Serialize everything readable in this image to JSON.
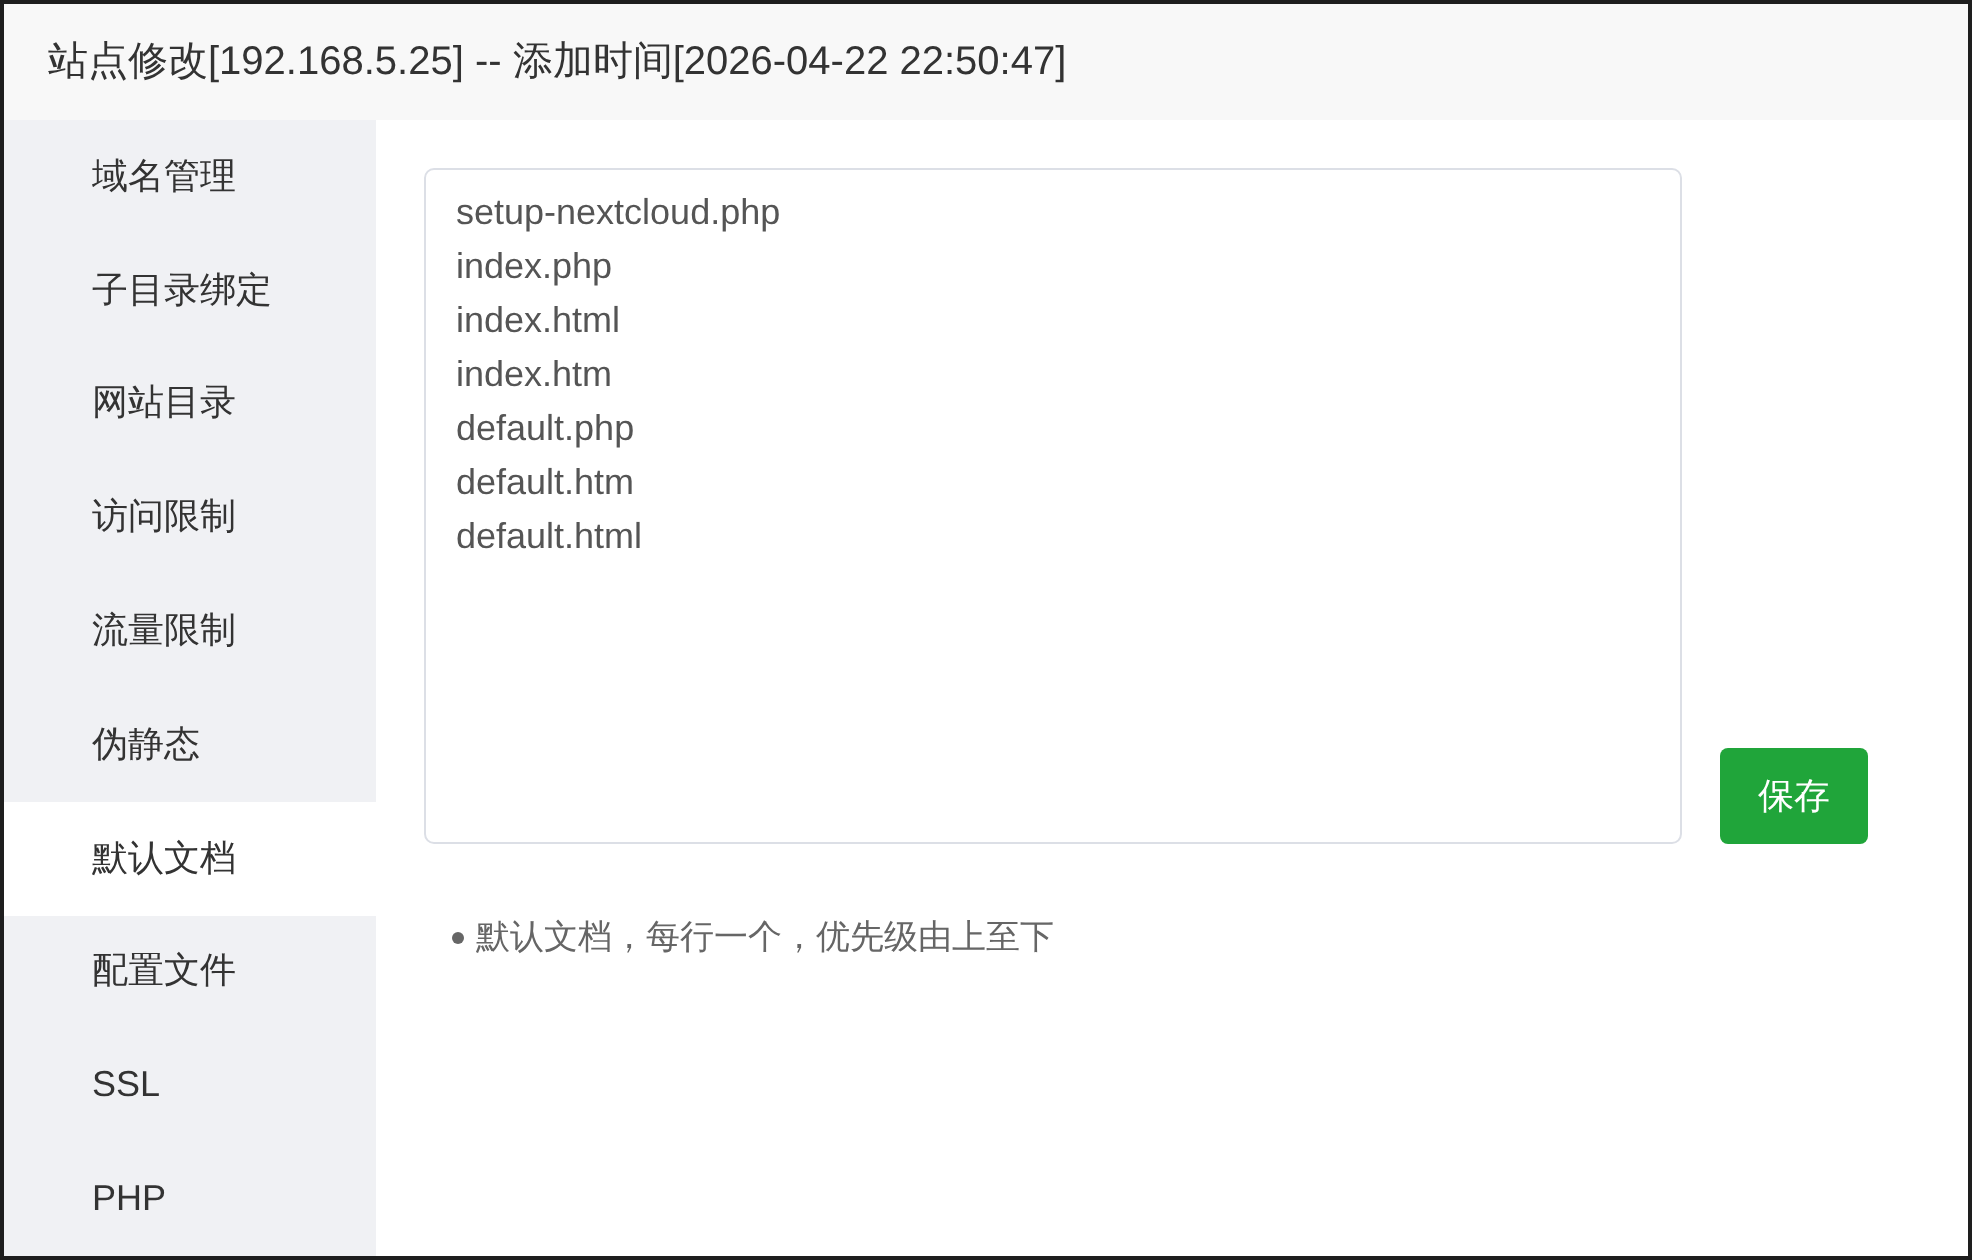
{
  "window": {
    "title": "站点修改[192.168.5.25] -- 添加时间[2026-04-22 22:50:47]"
  },
  "sidebar": {
    "items": [
      {
        "label": "域名管理",
        "selected": false
      },
      {
        "label": "子目录绑定",
        "selected": false
      },
      {
        "label": "网站目录",
        "selected": false
      },
      {
        "label": "访问限制",
        "selected": false
      },
      {
        "label": "流量限制",
        "selected": false
      },
      {
        "label": "伪静态",
        "selected": false
      },
      {
        "label": "默认文档",
        "selected": true
      },
      {
        "label": "配置文件",
        "selected": false
      },
      {
        "label": "SSL",
        "selected": false
      },
      {
        "label": "PHP",
        "selected": false
      }
    ]
  },
  "editor": {
    "lines": [
      "setup-nextcloud.php",
      "index.php",
      "index.html",
      "index.htm",
      "default.php",
      "default.htm",
      "default.html"
    ]
  },
  "save_button": {
    "label": "保存"
  },
  "hints": [
    "默认文档，每行一个，优先级由上至下"
  ]
}
